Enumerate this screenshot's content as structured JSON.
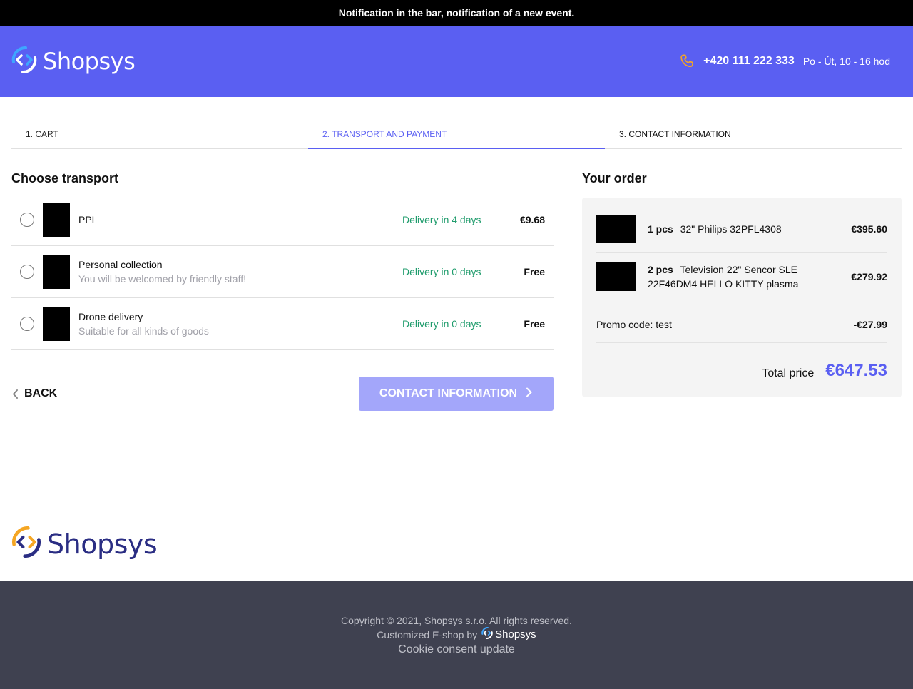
{
  "notification": "Notification in the bar, notification of a new event.",
  "header": {
    "logo_text": "Shopsys",
    "phone": "+420 111 222 333",
    "hours": "Po - Út, 10 - 16 hod"
  },
  "steps": [
    {
      "label": "1. Cart"
    },
    {
      "label": "2. Transport and payment"
    },
    {
      "label": "3. Contact information"
    }
  ],
  "transport": {
    "title": "Choose transport",
    "options": [
      {
        "name": "PPL",
        "description": "",
        "delivery": "Delivery in 4 days",
        "price": "€9.68"
      },
      {
        "name": "Personal collection",
        "description": "You will be welcomed by friendly staff!",
        "delivery": "Delivery in 0 days",
        "price": "Free"
      },
      {
        "name": "Drone delivery",
        "description": "Suitable for all kinds of goods",
        "delivery": "Delivery in 0 days",
        "price": "Free"
      }
    ]
  },
  "nav": {
    "back_label": "Back",
    "next_label": "Contact information"
  },
  "order": {
    "title": "Your order",
    "items": [
      {
        "qty": "1 pcs",
        "name": "32\" Philips 32PFL4308",
        "price": "€395.60"
      },
      {
        "qty": "2 pcs",
        "name": "Television 22\" Sencor SLE 22F46DM4 HELLO KITTY plasma",
        "price": "€279.92"
      }
    ],
    "promo_label": "Promo code: test",
    "promo_value": "-€27.99",
    "total_label": "Total price",
    "total_value": "€647.53"
  },
  "footer": {
    "logo_text": "Shopsys",
    "copyright": "Copyright © 2021, Shopsys s.r.o. All rights reserved.",
    "customized": "Customized E-shop by",
    "mini_logo_text": "Shopsys",
    "cookie": "Cookie consent update"
  },
  "colors": {
    "brand": "#5a5ff2",
    "brand_light": "#a3a6fa",
    "delivery_green": "#1f9c6c",
    "footer_bg": "#3f4150",
    "logo_orange": "#f5a623"
  }
}
